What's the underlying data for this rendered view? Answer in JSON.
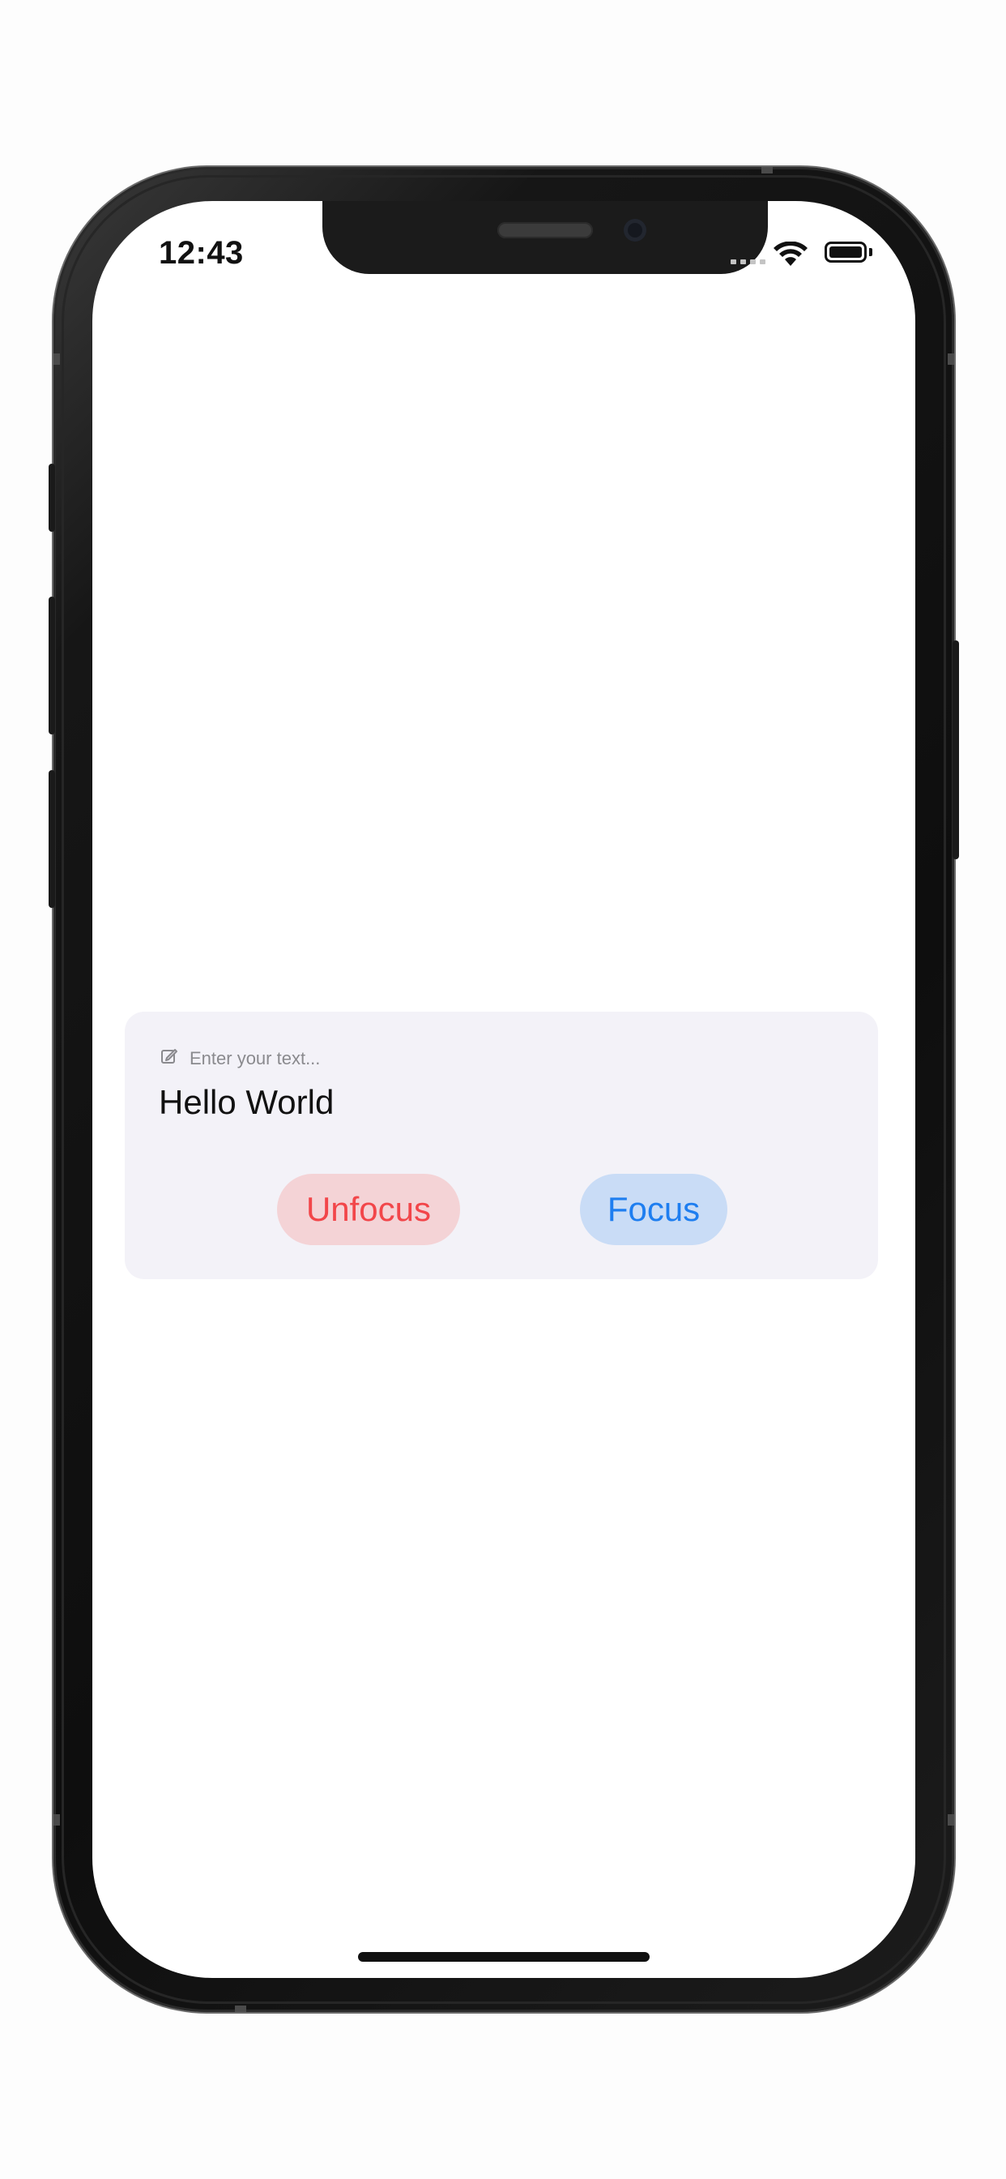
{
  "status_bar": {
    "time": "12:43",
    "wifi_icon": "wifi-icon",
    "battery_icon": "battery-full-icon",
    "signal_icon": "cellular-signal-icon"
  },
  "input": {
    "icon": "edit-icon",
    "placeholder": "Enter your text...",
    "value": "Hello World"
  },
  "buttons": {
    "unfocus_label": "Unfocus",
    "focus_label": "Focus"
  },
  "colors": {
    "card_background": "#f3f2f8",
    "unfocus_bg": "#f4d3d6",
    "unfocus_text": "#f2464a",
    "focus_bg": "#c9dcf6",
    "focus_text": "#1e7ef0"
  }
}
